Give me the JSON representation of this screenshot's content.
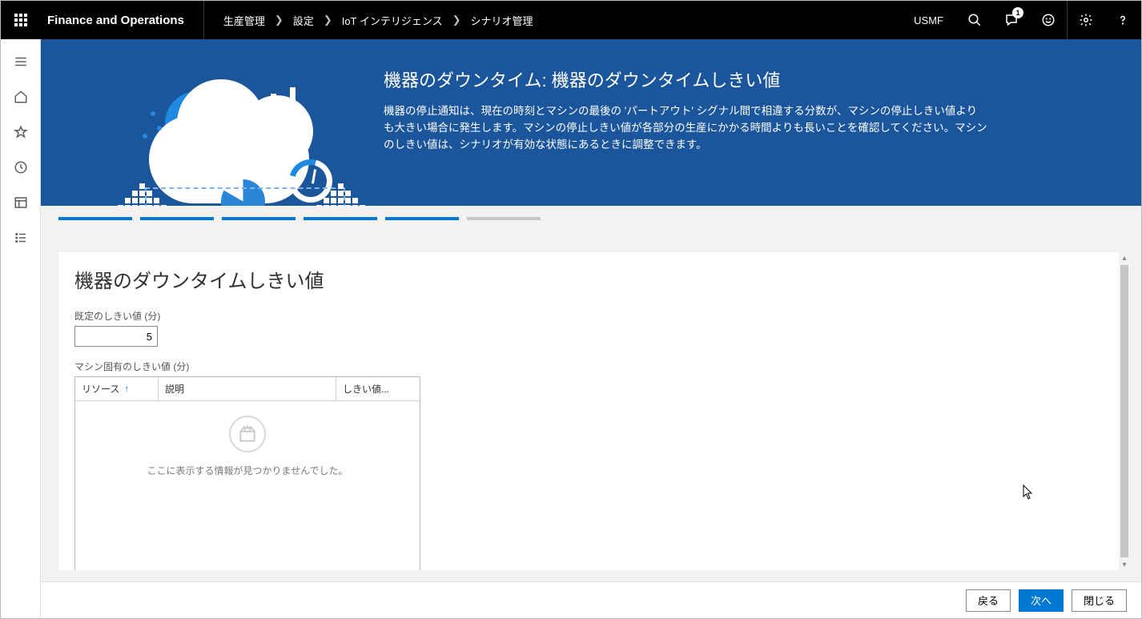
{
  "brand": "Finance and Operations",
  "company": "USMF",
  "notification_count": "1",
  "crumbs": [
    "生産管理",
    "設定",
    "IoT インテリジェンス",
    "シナリオ管理"
  ],
  "hero": {
    "title": "機器のダウンタイム: 機器のダウンタイムしきい値",
    "desc": "機器の停止通知は、現在の時刻とマシンの最後の 'パートアウト' シグナル間で相違する分数が、マシンの停止しきい値よりも大きい場合に発生します。マシンの停止しきい値が各部分の生産にかかる時間よりも長いことを確認してください。マシンのしきい値は、シナリオが有効な状態にあるときに調整できます。"
  },
  "wizard": {
    "total_steps": 6,
    "current": 5
  },
  "panel": {
    "heading": "機器のダウンタイムしきい値",
    "default_label": "既定のしきい値 (分)",
    "default_value": "5",
    "machine_label": "マシン固有のしきい値 (分)",
    "columns": {
      "c1": "リソース",
      "c2": "説明",
      "c3": "しきい値..."
    },
    "empty": "ここに表示する情報が見つかりませんでした。"
  },
  "footer": {
    "back": "戻る",
    "next": "次へ",
    "close": "閉じる"
  }
}
